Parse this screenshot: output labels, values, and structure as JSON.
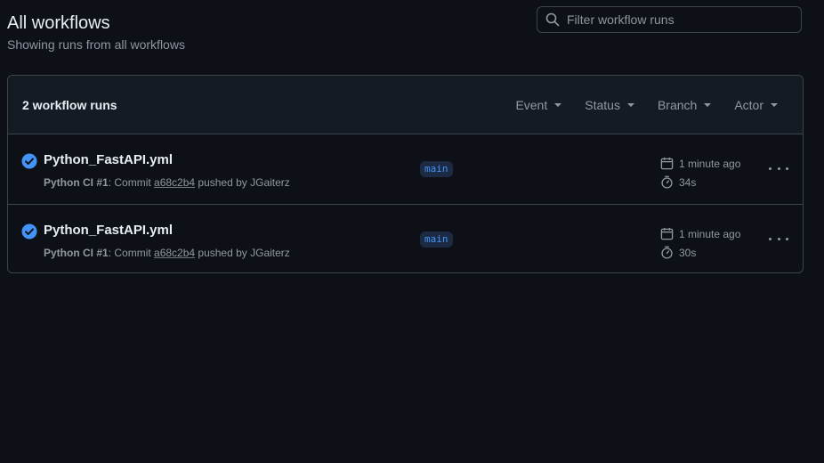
{
  "page": {
    "title": "All workflows",
    "subtitle": "Showing runs from all workflows"
  },
  "search": {
    "placeholder": "Filter workflow runs",
    "value": ""
  },
  "runs_header": {
    "count_label": "2 workflow runs",
    "filters": [
      {
        "label": "Event"
      },
      {
        "label": "Status"
      },
      {
        "label": "Branch"
      },
      {
        "label": "Actor"
      }
    ]
  },
  "runs": [
    {
      "status": "success",
      "title": "Python_FastAPI.yml",
      "workflow_ref": "Python CI #1",
      "commit_prefix": ": Commit ",
      "sha": "a68c2b4",
      "actor_text": " pushed by JGaiterz",
      "branch": "main",
      "time_ago": "1 minute ago",
      "duration": "34s"
    },
    {
      "status": "success",
      "title": "Python_FastAPI.yml",
      "workflow_ref": "Python CI #1",
      "commit_prefix": ": Commit ",
      "sha": "a68c2b4",
      "actor_text": " pushed by JGaiterz",
      "branch": "main",
      "time_ago": "1 minute ago",
      "duration": "30s"
    }
  ],
  "colors": {
    "background": "#0d1117",
    "success": "#4493f8",
    "border": "#3d444d",
    "muted_text": "#9198a1"
  },
  "icons": [
    "search-icon",
    "check-circle-icon",
    "calendar-icon",
    "stopwatch-icon",
    "kebab-horizontal-icon",
    "triangle-down-icon"
  ]
}
